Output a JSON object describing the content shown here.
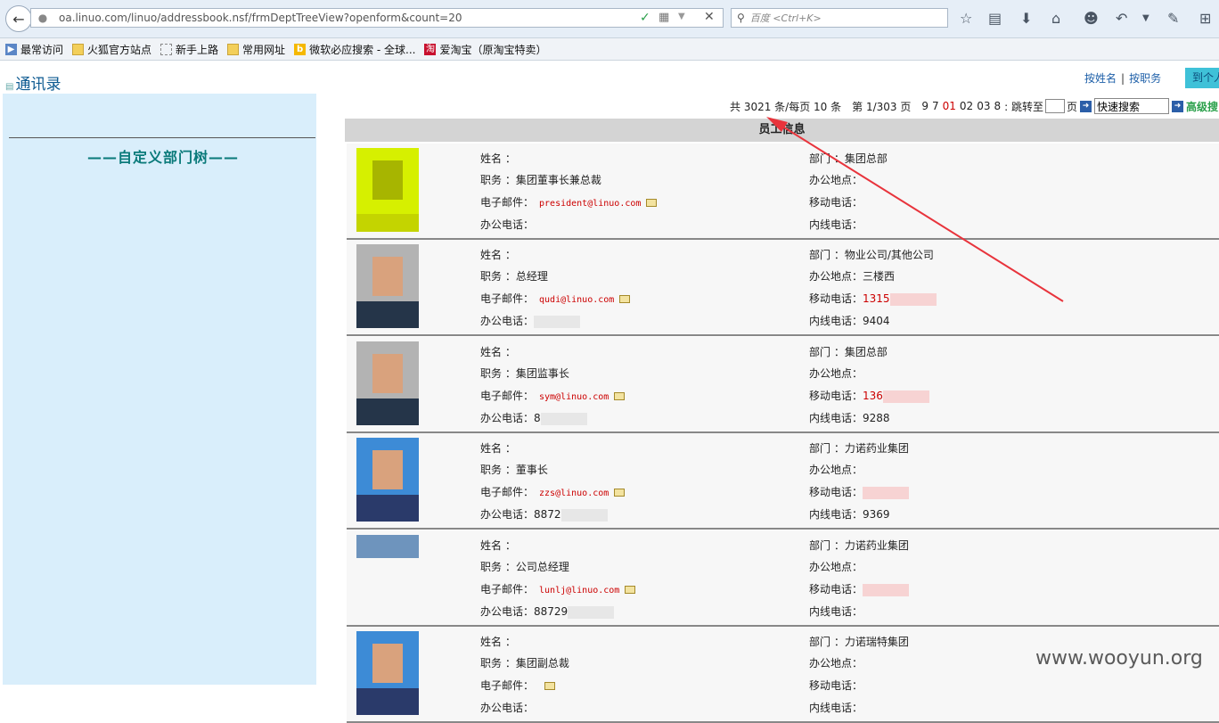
{
  "browser": {
    "url": "oa.linuo.com/linuo/addressbook.nsf/frmDeptTreeView?openform&count=20",
    "search_placeholder": "百度 <Ctrl+K>"
  },
  "bookmarks": [
    {
      "label": "最常访问",
      "icon": "blue"
    },
    {
      "label": "火狐官方站点",
      "icon": "folder"
    },
    {
      "label": "新手上路",
      "icon": "blank"
    },
    {
      "label": "常用网址",
      "icon": "folder"
    },
    {
      "label": "微软必应搜索 - 全球...",
      "icon": "bing"
    },
    {
      "label": "爱淘宝（原淘宝特卖）",
      "icon": "tao"
    }
  ],
  "page": {
    "title": "通讯录",
    "link_by_name": "按姓名",
    "link_sep": "|",
    "link_by_job": "按职务",
    "personal_btn": "到个人",
    "sidebar_title": "——自定义部门树——"
  },
  "pager": {
    "summary": "共 3021 条/每页 10 条",
    "page_info": "第 1/303 页",
    "pages": [
      "9",
      "7",
      "01",
      "02",
      "03",
      "8"
    ],
    "jump_label": ": 跳转至",
    "jump_suffix": "页",
    "quick_search_value": "快速搜索",
    "advanced": "高级搜"
  },
  "table_header": "员工信息",
  "labels": {
    "name": "姓名 ：",
    "job": "职务 ：",
    "email": "电子邮件：",
    "office_phone": "办公电话：",
    "dept": "部门 ：",
    "location": "办公地点：",
    "mobile": "移动电话：",
    "ext": "内线电话："
  },
  "employees": [
    {
      "job": "集团董事长兼总裁",
      "email": "president@linuo.com",
      "office_phone": "",
      "dept": "集团总部",
      "location": "",
      "mobile": "",
      "ext": "",
      "photo": "yellow"
    },
    {
      "job": "总经理",
      "email": "qudi@linuo.com",
      "office_phone": "",
      "dept": "物业公司/其他公司",
      "location": "三楼西",
      "mobile": "1315",
      "ext": "9404",
      "photo": "normal"
    },
    {
      "job": "集团监事长",
      "email": "sym@linuo.com",
      "office_phone": "8",
      "dept": "集团总部",
      "location": "",
      "mobile": "136",
      "ext": "9288",
      "photo": "normal"
    },
    {
      "job": "董事长",
      "email": "zzs@linuo.com",
      "office_phone": "8872",
      "dept": "力诺药业集团",
      "location": "",
      "mobile": "",
      "ext": "9369",
      "photo": "blue"
    },
    {
      "job": "公司总经理",
      "email": "lunlj@linuo.com",
      "office_phone": "88729",
      "dept": "力诺药业集团",
      "location": "",
      "mobile": "",
      "ext": "",
      "photo": "short"
    },
    {
      "job": "集团副总裁",
      "email": "",
      "office_phone": "",
      "dept": "力诺瑞特集团",
      "location": "",
      "mobile": "",
      "ext": "",
      "photo": "blue"
    }
  ],
  "watermark": "www.wooyun.org",
  "colors": {
    "annotation_arrow": "#e8343c",
    "link": "#1d5fa8",
    "sidebar": "#d9eefb"
  }
}
